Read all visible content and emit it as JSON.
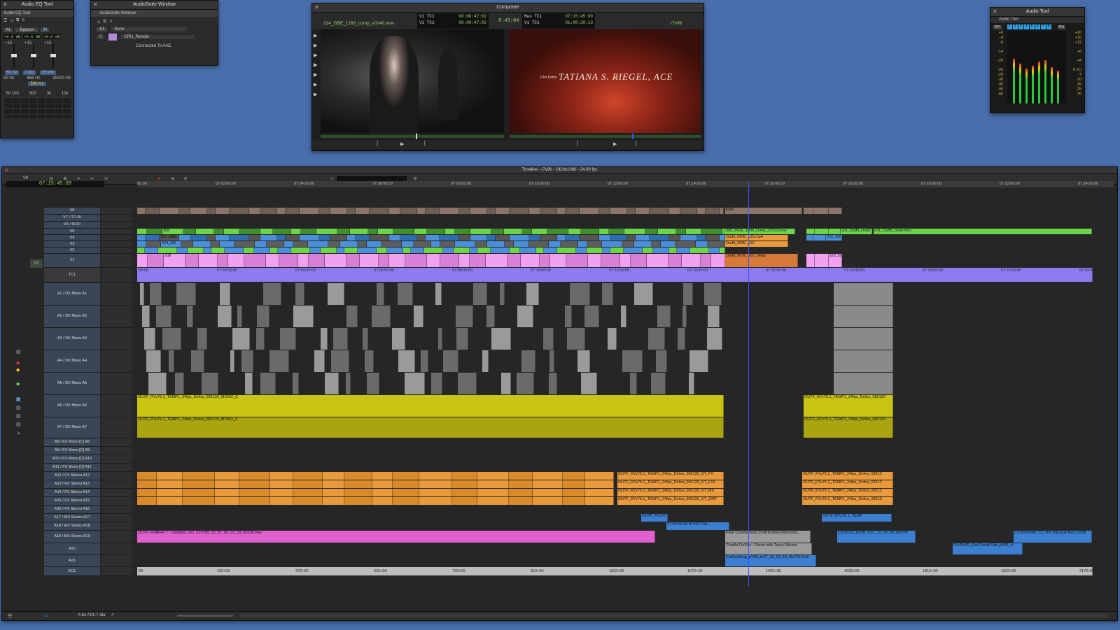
{
  "eq_tool": {
    "window_title": "Audio EQ Tool",
    "tab": "Audio EQ Tool",
    "track_select": "A1",
    "bypass_label": "Bypass",
    "in_label": "IN",
    "gains": [
      "+0.0 dB",
      "+0.0 dB",
      "+0.0 dB"
    ],
    "scale_top": [
      "+15",
      "+15",
      "+15"
    ],
    "freqs": [
      "50 Hz",
      "2 Oct",
      "15 kHz"
    ],
    "freq_row2": [
      "50 Hz",
      "866 Hz",
      "15000 Hz"
    ],
    "center_freq": "500 Hz",
    "bottom_labels": [
      "50 100",
      "500",
      "3k",
      "12k"
    ]
  },
  "audiosuite": {
    "window_title": "AudioSuite Window",
    "tab": "AudioSuite Window",
    "track_select": "A1",
    "plugin": "None",
    "render": "CRU_Render",
    "status": "Connected To AAE.",
    "counter": "0"
  },
  "composer": {
    "window_title": "Composer",
    "source_clip": "224_GBE_1260_comp_v0140.mov",
    "tc_rows_left": [
      {
        "label": "V1  TC1",
        "value": "00:00:47:02"
      },
      {
        "label": "V1  TC1",
        "value": "00:00:47:02"
      }
    ],
    "duration": "8:43:04",
    "tc_rows_right": [
      {
        "label": "Mas  TC1",
        "value": "07:15:45:09"
      },
      {
        "label": "V1  TC1",
        "value": "01:00:39:13"
      }
    ],
    "record_seq": "r7v96",
    "title_card": {
      "credit_small": "Film Editor",
      "name": "TATIANA S. RIEGEL, ACE"
    }
  },
  "audio_tool": {
    "window_title": "Audio Tool",
    "tab": "Audio Tool",
    "rp": "RP",
    "ph": "PH",
    "channels": [
      "1",
      "2",
      "3",
      "4",
      "5",
      "6",
      "7",
      "8"
    ],
    "left_scale": [
      "+0",
      "-4",
      "-8",
      "-14",
      "-20",
      "-26",
      "-28",
      "-30",
      "-35",
      "-45",
      "-90"
    ],
    "right_scale": [
      "+20",
      "+16",
      "+12",
      "+8",
      "+4",
      "0 VU",
      "-7",
      "-10",
      "-15",
      "-25",
      "-70"
    ]
  },
  "timeline": {
    "title": "Timeline - r7v96 - 1920x1080 - 24.00 fps",
    "master_tc": "07:15:45:09",
    "v_label": "V0",
    "ruler_ticks": [
      "00:00",
      "07:02:00:00",
      "07:04:00:00",
      "07:06:00:00",
      "07:08:00:00",
      "07:10:00:00",
      "07:12:00:00",
      "07:14:00:00",
      "07:16:00:00",
      "07:18:00:00",
      "07:20:00:00",
      "07:22:00:00",
      "07:24:00:00"
    ],
    "tc1_ticks": [
      "00:00",
      "07:02:00:00",
      "07:04:00:00",
      "07:06:00:00",
      "07:08:00:00",
      "07:10:00:00",
      "07:12:00:00",
      "07:14:00:00",
      "07:16:00:00",
      "07:18:00:00",
      "07:20:00:00",
      "07:22:00:00",
      "07:24:00:00"
    ],
    "ec1_ticks": [
      "00",
      "192+00",
      "372+00",
      "532+00",
      "732+00",
      "912+00",
      "1092+00",
      "1272+00",
      "1452+00",
      "1632+00",
      "1812+00",
      "1992+00",
      "2172+00"
    ],
    "tracks": [
      "V8",
      "V7 / TO DI",
      "V6 / IN DI",
      "V5",
      "V4",
      "V3",
      "V2",
      "V1",
      "TC1",
      "A1 / DX  Mono  A1",
      "A2 / DX  Mono  A2",
      "A3 / DX  Mono  A3",
      "A4 / DX  Mono  A4",
      "A5 / DX  Mono  A5",
      "A6 / DX  Mono  A6",
      "A7 / DX  Mono  A7",
      "A8 / FX  Mono  [C]  A8",
      "A9 / FX  Mono  [C]  A9",
      "A10 / FX  Mono  [C]  A10",
      "A11 / FX  Mono  [C]  A11",
      "A12 / FX  Stereo  A12",
      "A13 / FX  Stereo  A13",
      "A14 / FX  Stereo  A14",
      "A15 / FX  Stereo  A15",
      "A16 / FX  Stereo  A16",
      "A17 / MX  Stereo  A17",
      "A18 / MX  Stereo  A18",
      "A19 / MX  Stereo  A19",
      "A20",
      "A21",
      "EC1"
    ],
    "rec_track": "V1",
    "clip_labels": {
      "v6_filler": "Filler",
      "v5_comp": "300_MOE_1800_comp_v7013.mov",
      "v5_crawl1": "v01_Outfit_crawl",
      "v5_crawl2": "v01_Outfit_crawl.mov",
      "v3_mp4": "Outfit_MOE_v15.mp4",
      "v2_v10": "Outfit_MOE_v10",
      "v1_24": "Outfit_MOE_v03_24fps",
      "v_num_208": "208",
      "v_num_221": "221_GBE",
      "v_num_224": "224_GB",
      "v_num_222": "222_GB",
      "a6_main": "OUTF_R7v75.1_TEMP1_24fps_Delivs_082120_MONO_C",
      "a6_right": "OUTF_R7v75.1_TEMP1_24fps_Delivs_082120",
      "a12_main": "OUTF_R7v75.1_TEMP1_24fps_Delivs_082120_ST_FX",
      "a13_main": "OUTF_R7v75.1_TEMP1_24fps_Delivs_082120_ST_FOL",
      "a14_main": "OUTF_R7v75.1_TEMP1_24fps_Delivs_082120_ST_MX",
      "a15_main": "OUTF_R7v75.1_TEMP1_24fps_Delivs_082120_ST_GRP",
      "a12_right": "OUTF_R7v75.1_TEMP1_24fps_Delivs_08212",
      "a17_clip": "OUTF_R7v75",
      "a17_right": "OUTF_R7v75.1_TEMP",
      "a18_clip": "27:00:05:18 R7v93 FNL...",
      "a19_pink": "OUTF_FullReel 7 - Updated_v01_210105_TC 07_00_07_18_60100.wav",
      "a19_final": "Final Cruella Song Draft Embed (Ramona...",
      "a19_right": "Cru3m23_pV9B_tc07_19_14_09_Mx703",
      "a19_far": "Cru3m03bA1.T3_The Baroque Ball_pV9B",
      "a20_clip": "Cruella DeVille - Demo with Taura Stinson",
      "a20_right": "Cru3m20_End Credit Edit_pV96_tc",
      "a21_clip": "CruEmSong_pV95_tc07_18_03_19_Mx7221Full"
    },
    "bottom_text": "A tor A01-7 dia"
  },
  "colors": {
    "desktop": "#4a6eab",
    "video_green": "#6cd64a",
    "video_blue": "#4a8fd8",
    "video_pink": "#f2a0f0",
    "dialogue_gray": "#8a8a8a",
    "dialogue_yellow": "#c8c414",
    "fx_orange": "#e89a3c",
    "music_pink": "#e060d0",
    "music_blue": "#3c7fd0",
    "tc_purple": "#8c7cf0",
    "timecode_green": "#9fd46a"
  }
}
